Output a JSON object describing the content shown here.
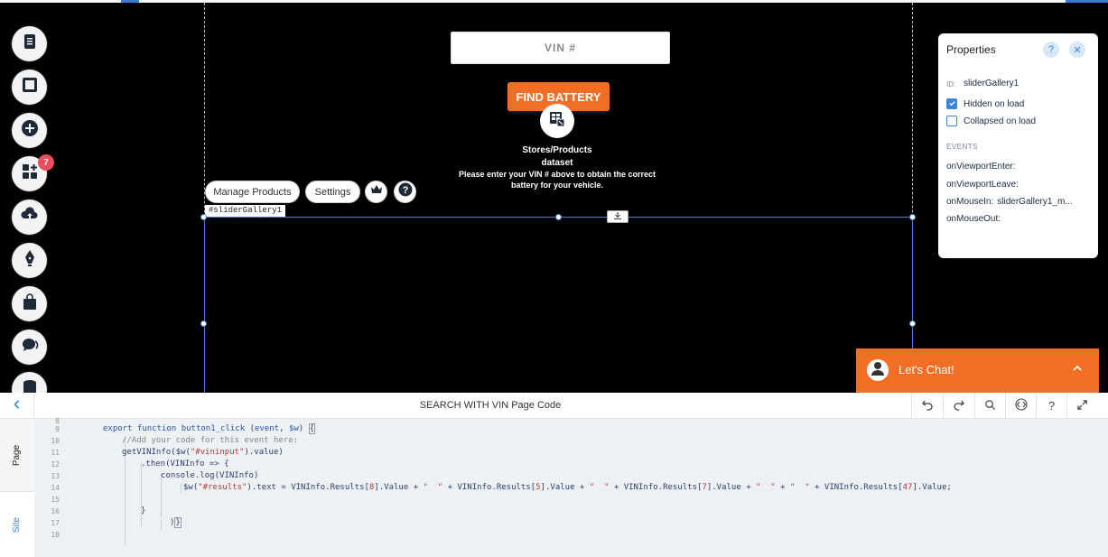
{
  "top_strip": {},
  "left_toolbar": {
    "items": [
      {
        "name": "pages-menu-icon"
      },
      {
        "name": "background-icon"
      },
      {
        "name": "add-icon"
      },
      {
        "name": "app-market-icon"
      },
      {
        "name": "upload-icon"
      },
      {
        "name": "blog-icon"
      },
      {
        "name": "store-icon"
      },
      {
        "name": "chat-icon"
      },
      {
        "name": "database-icon"
      }
    ],
    "apps_badge": "7"
  },
  "canvas": {
    "vin_placeholder": "VIN #",
    "find_button": "FIND BATTERY",
    "dataset_label_line1": "Stores/Products",
    "dataset_label_line2": "dataset",
    "results_line1": "Please enter your VIN # above to obtain the correct",
    "results_line2": "battery for your vehicle.",
    "manage_products": "Manage Products",
    "settings": "Settings",
    "element_tag": "#sliderGallery1"
  },
  "properties": {
    "title": "Properties",
    "help": "?",
    "close": "✕",
    "id_label": "ID:",
    "id_value": "sliderGallery1",
    "hidden_on_load": "Hidden on load",
    "hidden_checked": true,
    "collapsed_on_load": "Collapsed on load",
    "collapsed_checked": false,
    "events_heading": "EVENTS",
    "events": [
      {
        "name": "onViewportEnter:",
        "handler": ""
      },
      {
        "name": "onViewportLeave:",
        "handler": ""
      },
      {
        "name": "onMouseIn:",
        "handler": "sliderGallery1_m..."
      },
      {
        "name": "onMouseOut:",
        "handler": ""
      }
    ]
  },
  "chat": {
    "label": "Let's Chat!",
    "accent": "#f26e24"
  },
  "code_panel": {
    "title": "SEARCH WITH VIN Page Code",
    "tabs": {
      "page": "Page",
      "site": "Site"
    },
    "toolbar": [
      "undo-icon",
      "redo-icon",
      "search-icon",
      "code-props-icon",
      "help-icon",
      "expand-icon"
    ],
    "help_label": "?",
    "line_numbers": [
      "8",
      "9",
      "10",
      "11",
      "12",
      "13",
      "14",
      "15",
      "16",
      "17",
      "18"
    ]
  },
  "colors": {
    "canvas_bg": "#000000",
    "selection": "#3f7ed6",
    "accent_orange": "#f26e24",
    "badge_red": "#ea4d5b"
  }
}
